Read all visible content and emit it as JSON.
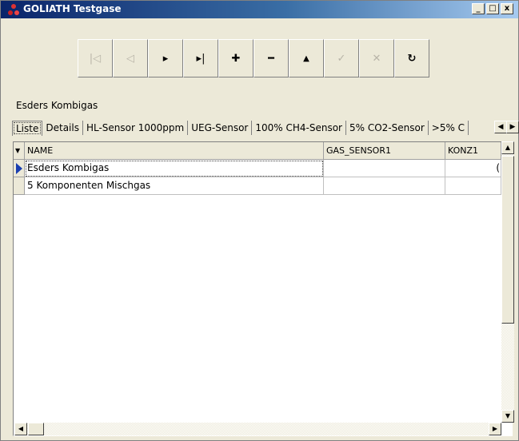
{
  "window": {
    "title": "GOLIATH Testgase",
    "controls": {
      "minimize": "_",
      "maximize": "□",
      "close": "x"
    }
  },
  "navigator": {
    "buttons": [
      {
        "name": "first-record",
        "icon": "⏮",
        "glyph": "|◁",
        "enabled": false
      },
      {
        "name": "prior-record",
        "icon": "◁",
        "glyph": "◁",
        "enabled": false
      },
      {
        "name": "next-record",
        "icon": "▶",
        "glyph": "▸",
        "enabled": true
      },
      {
        "name": "last-record",
        "icon": "▶|",
        "glyph": "▸|",
        "enabled": true
      },
      {
        "name": "insert-record",
        "icon": "+",
        "glyph": "✚",
        "enabled": true
      },
      {
        "name": "delete-record",
        "icon": "−",
        "glyph": "━",
        "enabled": true
      },
      {
        "name": "edit-record",
        "icon": "▲",
        "glyph": "▲",
        "enabled": true
      },
      {
        "name": "post-edit",
        "icon": "✓",
        "glyph": "✓",
        "enabled": false
      },
      {
        "name": "cancel-edit",
        "icon": "✕",
        "glyph": "✕",
        "enabled": false
      },
      {
        "name": "refresh",
        "icon": "↻",
        "glyph": "↻",
        "enabled": true
      }
    ]
  },
  "current_record": "Esders Kombigas",
  "tabs": [
    "Liste",
    "Details",
    "HL-Sensor 1000ppm",
    "UEG-Sensor",
    "100% CH4-Sensor",
    "5% CO2-Sensor",
    ">5% C"
  ],
  "active_tab": "Liste",
  "grid": {
    "columns": [
      "NAME",
      "GAS_SENSOR1",
      "KONZ1"
    ],
    "rows": [
      {
        "name": "Esders Kombigas",
        "gas_sensor1": "",
        "konz1": "(",
        "selected": true
      },
      {
        "name": "5 Komponenten Mischgas",
        "gas_sensor1": "",
        "konz1": "",
        "selected": false
      }
    ]
  }
}
